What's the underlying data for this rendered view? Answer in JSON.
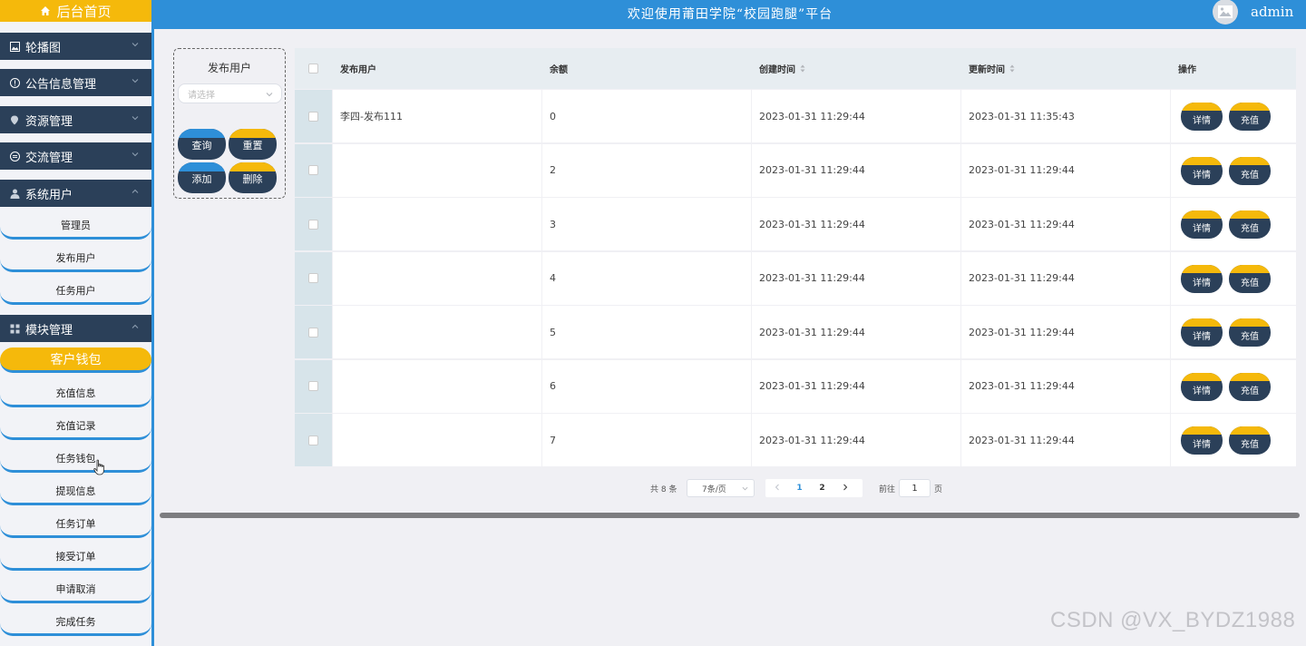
{
  "sidebar": {
    "home_label": "后台首页",
    "menus": [
      {
        "label": "轮播图",
        "icon": "image-icon"
      },
      {
        "label": "公告信息管理",
        "icon": "info-icon"
      },
      {
        "label": "资源管理",
        "icon": "location-icon"
      },
      {
        "label": "交流管理",
        "icon": "chat-icon"
      },
      {
        "label": "系统用户",
        "icon": "user-icon"
      },
      {
        "label": "模块管理",
        "icon": "grid-icon"
      }
    ],
    "system_users": [
      "管理员",
      "发布用户",
      "任务用户"
    ],
    "modules": [
      "客户钱包",
      "充值信息",
      "充值记录",
      "任务钱包",
      "提现信息",
      "任务订单",
      "接受订单",
      "申请取消",
      "完成任务"
    ],
    "active_item": "客户钱包"
  },
  "header": {
    "title": "欢迎使用莆田学院“校园跑腿”平台",
    "username": "admin"
  },
  "search": {
    "label": "发布用户",
    "placeholder": "请选择",
    "query_label": "查询",
    "reset_label": "重置",
    "add_label": "添加",
    "delete_label": "删除"
  },
  "table": {
    "columns": [
      "发布用户",
      "余额",
      "创建时间",
      "更新时间",
      "操作"
    ],
    "detail_label": "详情",
    "recharge_label": "充值",
    "rows": [
      {
        "user": "李四-发布111",
        "balance": "0",
        "created": "2023-01-31 11:29:44",
        "updated": "2023-01-31 11:35:43"
      },
      {
        "user": "",
        "balance": "2",
        "created": "2023-01-31 11:29:44",
        "updated": "2023-01-31 11:29:44"
      },
      {
        "user": "",
        "balance": "3",
        "created": "2023-01-31 11:29:44",
        "updated": "2023-01-31 11:29:44"
      },
      {
        "user": "",
        "balance": "4",
        "created": "2023-01-31 11:29:44",
        "updated": "2023-01-31 11:29:44"
      },
      {
        "user": "",
        "balance": "5",
        "created": "2023-01-31 11:29:44",
        "updated": "2023-01-31 11:29:44"
      },
      {
        "user": "",
        "balance": "6",
        "created": "2023-01-31 11:29:44",
        "updated": "2023-01-31 11:29:44"
      },
      {
        "user": "",
        "balance": "7",
        "created": "2023-01-31 11:29:44",
        "updated": "2023-01-31 11:29:44"
      }
    ]
  },
  "pagination": {
    "total": "共 8 条",
    "page_size": "7条/页",
    "pages": [
      "1",
      "2"
    ],
    "current": "1",
    "goto_label": "前往",
    "goto_value": "1",
    "page_suffix": "页"
  },
  "watermark": "CSDN @VX_BYDZ1988",
  "colors": {
    "accent_blue": "#2e8fd8",
    "accent_yellow": "#f5b90b",
    "navy": "#2b4059"
  }
}
